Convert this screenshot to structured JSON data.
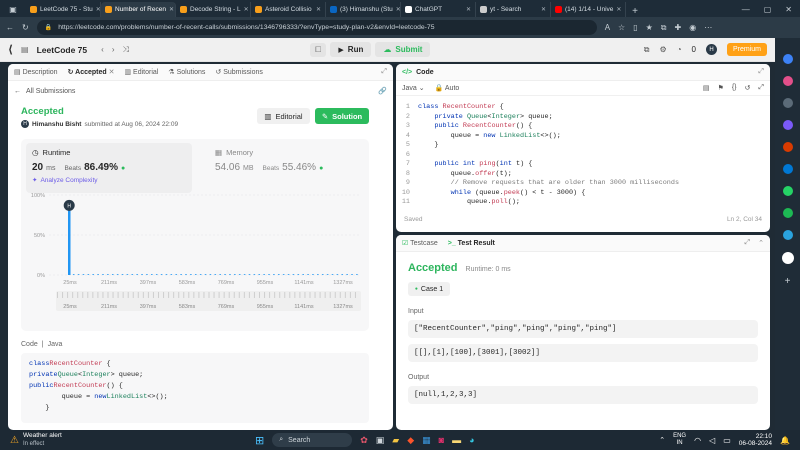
{
  "browser": {
    "tabs": [
      {
        "label": "LeetCode 75 - Stu",
        "color": "#f89f1b",
        "active": false
      },
      {
        "label": "Number of Recen",
        "color": "#f89f1b",
        "active": true
      },
      {
        "label": "Decode String - L",
        "color": "#f89f1b",
        "active": false
      },
      {
        "label": "Asteroid Collisio",
        "color": "#f89f1b",
        "active": false
      },
      {
        "label": "(3) Himanshu (Stu",
        "color": "#0a66c2",
        "active": false
      },
      {
        "label": "ChatGPT",
        "color": "#ffffff",
        "active": false
      },
      {
        "label": "yt - Search",
        "color": "#cccccc",
        "active": false
      },
      {
        "label": "(14) 1/14 - Unive",
        "color": "#ff0000",
        "active": false
      }
    ],
    "new_tab": "+",
    "url": "https://leetcode.com/problems/number-of-recent-calls/submissions/1346796333/?envType=study-plan-v2&envId=leetcode-75"
  },
  "header": {
    "study_plan": "LeetCode 75",
    "run": "Run",
    "submit": "Submit",
    "fire_count": "0",
    "avatar_initial": "H",
    "premium": "Premium"
  },
  "left_tabs": {
    "description": "Description",
    "accepted": "Accepted",
    "editorial": "Editorial",
    "solutions": "Solutions",
    "submissions": "Submissions"
  },
  "submission": {
    "back": "All Submissions",
    "status": "Accepted",
    "author": "Himanshu Bisht",
    "submitted_at": "submitted at Aug 06, 2024 22:09",
    "avatar_initial": "H",
    "editorial_btn": "Editorial",
    "solution_btn": "Solution",
    "runtime_label": "Runtime",
    "runtime_value": "20",
    "runtime_unit": "ms",
    "beats_label": "Beats",
    "runtime_beats": "86.49%",
    "analyze": "Analyze Complexity",
    "memory_label": "Memory",
    "memory_value": "54.06",
    "memory_unit": "MB",
    "memory_beats_label": "Beats",
    "memory_beats": "55.46%"
  },
  "chart_data": {
    "type": "bar",
    "categories": [
      "25ms",
      "211ms",
      "397ms",
      "583ms",
      "769ms",
      "955ms",
      "1141ms",
      "1327ms"
    ],
    "y_ticks": [
      "100%",
      "50%",
      "0%"
    ],
    "ylim": [
      0,
      100
    ],
    "highlight": {
      "category": "25ms",
      "value": 82,
      "label": "H"
    },
    "tail_value": 1,
    "nav_ticks": [
      "25ms",
      "211ms",
      "397ms",
      "583ms",
      "769ms",
      "955ms",
      "1141ms",
      "1327ms"
    ]
  },
  "bottom_code": {
    "label": "Code",
    "lang": "Java",
    "lines": [
      "class RecentCounter {",
      "    private Queue<Integer> queue;",
      "    public RecentCounter() {",
      "        queue = new LinkedList<>();",
      "    }"
    ]
  },
  "editor": {
    "title": "Code",
    "lang": "Java",
    "mode": "Auto",
    "saved": "Saved",
    "cursor": "Ln 2, Col 34",
    "lines": [
      {
        "n": "1",
        "t": "class RecentCounter {"
      },
      {
        "n": "2",
        "t": "    private Queue<Integer> queue;"
      },
      {
        "n": "3",
        "t": "    public RecentCounter() {"
      },
      {
        "n": "4",
        "t": "        queue = new LinkedList<>();"
      },
      {
        "n": "5",
        "t": "    }"
      },
      {
        "n": "6",
        "t": ""
      },
      {
        "n": "7",
        "t": "    public int ping(int t) {"
      },
      {
        "n": "8",
        "t": "        queue.offer(t);"
      },
      {
        "n": "9",
        "t": "        // Remove requests that are older than 3000 milliseconds"
      },
      {
        "n": "10",
        "t": "        while (queue.peek() < t - 3000) {"
      },
      {
        "n": "11",
        "t": "            queue.poll();"
      }
    ]
  },
  "result": {
    "testcase_tab": "Testcase",
    "result_tab": "Test Result",
    "status": "Accepted",
    "runtime": "Runtime: 0 ms",
    "case": "Case 1",
    "input_label": "Input",
    "input_1": "[\"RecentCounter\",\"ping\",\"ping\",\"ping\",\"ping\"]",
    "input_2": "[[],[1],[100],[3001],[3002]]",
    "output_label": "Output",
    "output": "[null,1,2,3,3]"
  },
  "taskbar": {
    "weather_title": "Weather alert",
    "weather_sub": "In effect",
    "search": "Search",
    "lang_top": "ENG",
    "lang_bottom": "IN",
    "time": "22:10",
    "date": "06-08-2024"
  },
  "colors": {
    "accepted": "#2db55d",
    "solution_btn": "#2cbb5d",
    "premium": "#ffa116",
    "bar": "#2196f3"
  }
}
